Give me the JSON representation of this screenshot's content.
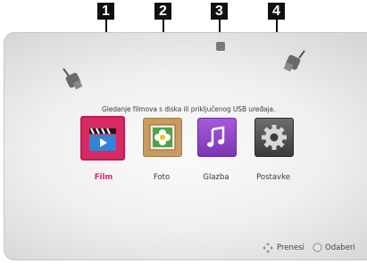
{
  "callouts": [
    {
      "number": "1"
    },
    {
      "number": "2"
    },
    {
      "number": "3"
    },
    {
      "number": "4"
    }
  ],
  "hint_text": "Gledanje filmova s diska ili priključenog USB uređaja.",
  "menu": {
    "items": [
      {
        "label": "Film",
        "icon": "film-clapperboard-icon",
        "selected": true
      },
      {
        "label": "Foto",
        "icon": "flower-photo-icon",
        "selected": false
      },
      {
        "label": "Glazba",
        "icon": "music-note-icon",
        "selected": false
      },
      {
        "label": "Postavke",
        "icon": "gear-icon",
        "selected": false
      }
    ]
  },
  "footer": {
    "move_label": "Prenesi",
    "move_icon": "navigation-arrows-icon",
    "select_label": "Odaberi",
    "select_icon": "ok-button-icon"
  },
  "colors": {
    "accent": "#d72a63",
    "callout": "#111111"
  }
}
